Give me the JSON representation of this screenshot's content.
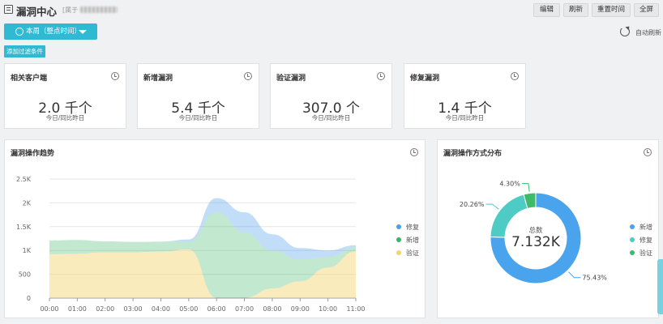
{
  "header": {
    "title": "漏洞中心",
    "owner_prefix": "[属于",
    "buttons": [
      "编辑",
      "刷新",
      "重置时间",
      "全屏"
    ]
  },
  "toolbar": {
    "time_range": "本周（整点时间）",
    "auto_refresh": "自动刷新",
    "add_filter": "添加过滤条件"
  },
  "stats": [
    {
      "title": "相关客户端",
      "value": "2.0 千个",
      "sub": "今日/同比昨日"
    },
    {
      "title": "新增漏洞",
      "value": "5.4 千个",
      "sub": "今日/同比昨日"
    },
    {
      "title": "验证漏洞",
      "value": "307.0 个",
      "sub": "今日/同比昨日"
    },
    {
      "title": "修复漏洞",
      "value": "1.4 千个",
      "sub": "今日/同比昨日"
    }
  ],
  "trend": {
    "title": "漏洞操作趋势",
    "legend": [
      "修复",
      "新增",
      "验证"
    ]
  },
  "distribution": {
    "title": "漏洞操作方式分布",
    "center_label": "总数",
    "center_value": "7.132K",
    "legend": [
      "新增",
      "修复",
      "验证"
    ]
  },
  "colors": {
    "accent": "#2fb9d3",
    "repair": "#4e9fe9",
    "new": "#34b765",
    "verify": "#f5d36a",
    "donut_new": "#4aa3ed",
    "donut_repair": "#4fcbc6",
    "donut_verify": "#3dbb6b"
  },
  "chart_data": [
    {
      "type": "area",
      "title": "漏洞操作趋势",
      "x": [
        "00:00",
        "01:00",
        "02:00",
        "03:00",
        "04:00",
        "05:00",
        "06:00",
        "07:00",
        "08:00",
        "09:00",
        "10:00",
        "11:00"
      ],
      "ylim": [
        0,
        2500
      ],
      "yticks": [
        0,
        500,
        1000,
        1500,
        2000,
        2500
      ],
      "ytick_labels": [
        "0",
        "500",
        "1K",
        "1.5K",
        "2K",
        "2.5K"
      ],
      "series": [
        {
          "name": "修复",
          "values": [
            0,
            0,
            0,
            0,
            0,
            50,
            300,
            420,
            340,
            240,
            140,
            50
          ]
        },
        {
          "name": "新增",
          "values": [
            290,
            290,
            230,
            220,
            210,
            160,
            1800,
            1380,
            800,
            460,
            220,
            80
          ]
        },
        {
          "name": "验证",
          "values": [
            920,
            930,
            960,
            960,
            975,
            1020,
            0,
            0,
            200,
            350,
            640,
            980
          ]
        }
      ],
      "legend_position": "right"
    },
    {
      "type": "pie",
      "title": "漏洞操作方式分布",
      "categories": [
        "新增",
        "修复",
        "验证"
      ],
      "values": [
        75.43,
        20.26,
        4.3
      ],
      "value_labels": [
        "75.43%",
        "20.26%",
        "4.30%"
      ]
    }
  ]
}
